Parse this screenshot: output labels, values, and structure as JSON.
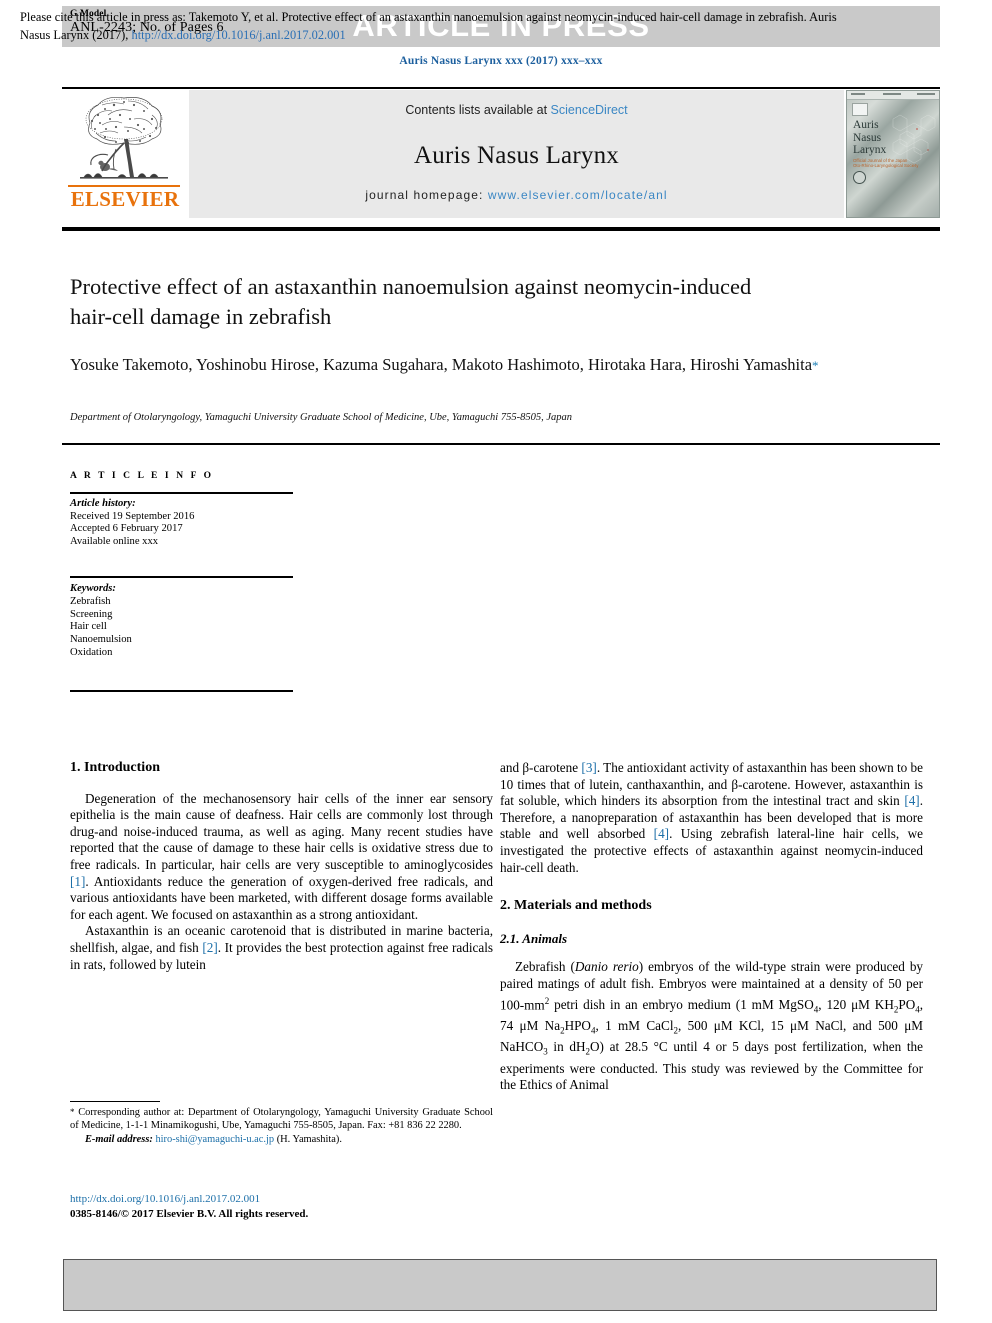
{
  "header": {
    "g_model": "G Model",
    "model_number": "ANL-2243; No. of Pages 6",
    "article_in_press": "ARTICLE IN PRESS",
    "journal_reference": "Auris Nasus Larynx xxx (2017) xxx–xxx"
  },
  "banner": {
    "publisher": "ELSEVIER",
    "contents_prefix": "Contents lists available at ",
    "contents_link": "ScienceDirect",
    "journal_title": "Auris Nasus Larynx",
    "homepage_label": "journal homepage: ",
    "homepage_url": "www.elsevier.com/locate/anl",
    "cover": {
      "line1": "Auris",
      "line2": "Nasus",
      "line3": "Larynx",
      "subtitle": "Official Journal of the Japan\nOto-Rhino-Laryngological Society"
    }
  },
  "article": {
    "title": "Protective effect of an astaxanthin nanoemulsion against neomycin-induced hair-cell damage in zebrafish",
    "authors": "Yosuke Takemoto, Yoshinobu Hirose, Kazuma Sugahara, Makoto Hashimoto, Hirotaka Hara, Hiroshi Yamashita",
    "corresponding_marker": "*",
    "affiliation": "Department of Otolaryngology, Yamaguchi University Graduate School of Medicine, Ube, Yamaguchi 755-8505, Japan"
  },
  "article_info": {
    "heading": "A R T I C L E   I N F O",
    "history_label": "Article history:",
    "history": [
      "Received 19 September 2016",
      "Accepted 6 February 2017",
      "Available online xxx"
    ],
    "keywords_label": "Keywords:",
    "keywords": [
      "Zebrafish",
      "Screening",
      "Hair cell",
      "Nanoemulsion",
      "Oxidation"
    ]
  },
  "body": {
    "section1_heading": "1.  Introduction",
    "intro_p1_a": "Degeneration of the mechanosensory hair cells of the inner ear sensory epithelia is the main cause of deafness. Hair cells are commonly lost through drug-and noise-induced trauma, as well as aging. Many recent studies have reported that the cause of damage to these hair cells is oxidative stress due to free radicals. In particular, hair cells are very susceptible to aminoglycosides ",
    "intro_p1_ref1": "[1]",
    "intro_p1_b": ". Antioxidants reduce the generation of oxygen-derived free radicals, and various antioxidants have been marketed, with different dosage forms available for each agent. We focused on astaxanthin as a strong antioxidant.",
    "intro_p2_a": "Astaxanthin is an oceanic carotenoid that is distributed in marine bacteria, shellfish, algae, and fish ",
    "intro_p2_ref2": "[2]",
    "intro_p2_b": ". It provides the best protection against free radicals in rats, followed by lutein",
    "intro_p3_a": "and β-carotene ",
    "intro_p3_ref3": "[3]",
    "intro_p3_b": ". The antioxidant activity of astaxanthin has been shown to be 10 times that of lutein, canthaxanthin, and β-carotene. However, astaxanthin is fat soluble, which hinders its absorption from the intestinal tract and skin ",
    "intro_p3_ref4a": "[4]",
    "intro_p3_c": ". Therefore, a nanopreparation of astaxanthin has been developed that is more stable and well absorbed ",
    "intro_p3_ref4b": "[4]",
    "intro_p3_d": ". Using zebrafish lateral-line hair cells, we investigated the protective effects of astaxanthin against neomycin-induced hair-cell death.",
    "section2_heading": "2.  Materials and methods",
    "subsection21_heading": "2.1.  Animals",
    "animals_a": "Zebrafish (",
    "animals_italic": "Danio rerio",
    "animals_b": ") embryos of the wild-type strain were produced by paired matings of adult fish. Embryos were maintained at a density of 50 per 100-mm",
    "animals_sup": "2",
    "animals_c": " petri dish in an embryo medium (1 mM MgSO",
    "animals_formula_full": "embryo medium (1 mM MgSO4, 120 μM KH2PO4, 74 μM Na2HPO4, 1 mM CaCl2, 500 μM KCl, 15 μM NaCl, and 500 μM NaHCO3 in dH2O) at 28.5 °C until 4 or 5 days post fertilization, when the experiments were conducted. This study was reviewed by the Committee for the Ethics of Animal"
  },
  "footnote": {
    "star": "*",
    "corresponding": " Corresponding author at: Department of Otolaryngology, Yamaguchi University Graduate School of Medicine, 1-1-1 Minamikogushi, Ube, Yamaguchi 755-8505, Japan. Fax: +81 836 22 2280.",
    "email_label": "E-mail address:",
    "email": "hiro-shi@yamaguchi-u.ac.jp",
    "email_owner": "(H. Yamashita).",
    "doi": "http://dx.doi.org/10.1016/j.anl.2017.02.001",
    "copyright": "0385-8146/© 2017 Elsevier B.V. All rights reserved."
  },
  "citation_box": {
    "text_a": "Please cite this article in press as: Takemoto Y, et al. Protective effect of an astaxanthin nanoemulsion against neomycin-induced hair-cell damage in zebrafish. Auris Nasus Larynx (2017), ",
    "link": "http://dx.doi.org/10.1016/j.anl.2017.02.001"
  },
  "colors": {
    "band_gray": "#c9c9c9",
    "link_blue": "#1c6fa8",
    "journal_blue": "#1c5f9e",
    "elsevier_orange": "#e8720c",
    "contents_gray": "#e9e9e9"
  }
}
